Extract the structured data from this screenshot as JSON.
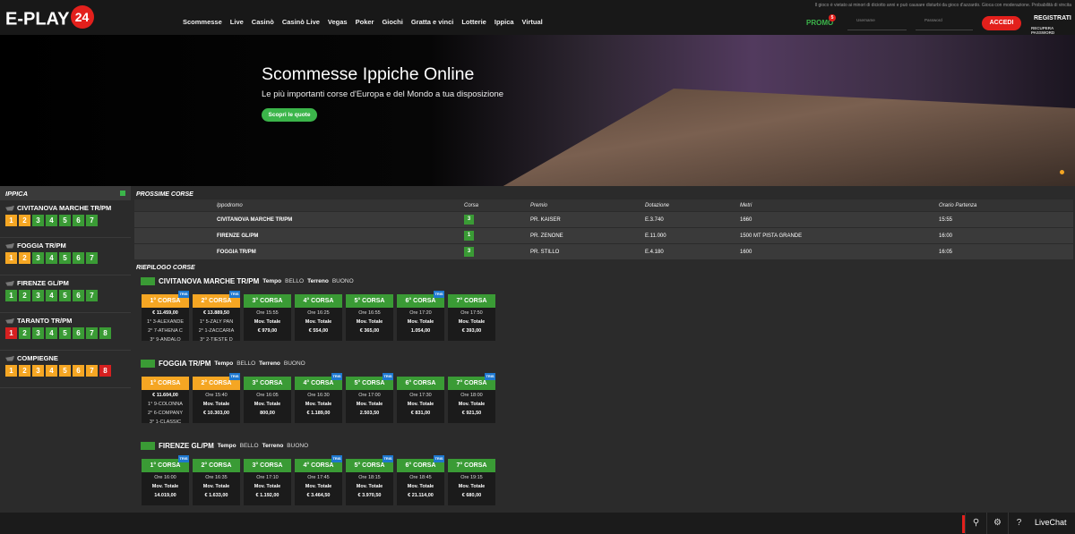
{
  "header": {
    "logo_text": "E-PLAY",
    "logo_num": "24",
    "nav": [
      "Scommesse",
      "Live",
      "Casinò",
      "Casinò Live",
      "Vegas",
      "Poker",
      "Giochi",
      "Gratta e vinci",
      "Lotterie",
      "Ippica",
      "Virtual"
    ],
    "disclaimer": "Il gioco è vietato ai minori di diciotto anni e può causare disturbi da gioco d'azzardo. Gioca con moderazione. Probabilità di vincita",
    "promo_label": "PROMO",
    "promo_count": "5",
    "username_placeholder": "Username",
    "password_placeholder": "Password",
    "login_button": "ACCEDI",
    "register": "REGISTRATI",
    "recover": "RECUPERA PASSWORD"
  },
  "hero": {
    "title": "Scommesse Ippiche Online",
    "subtitle": "Le più importanti corse d'Europa e del Mondo a tua disposizione",
    "cta": "Scopri le quote"
  },
  "sidebar": {
    "title": "IPPICA",
    "venues": [
      {
        "name": "CIVITANOVA MARCHE TR/PM",
        "races": [
          [
            "1",
            "o"
          ],
          [
            "2",
            "o"
          ],
          [
            "3",
            "g"
          ],
          [
            "4",
            "g"
          ],
          [
            "5",
            "g"
          ],
          [
            "6",
            "g"
          ],
          [
            "7",
            "g"
          ]
        ]
      },
      {
        "name": "FOGGIA TR/PM",
        "races": [
          [
            "1",
            "o"
          ],
          [
            "2",
            "o"
          ],
          [
            "3",
            "g"
          ],
          [
            "4",
            "g"
          ],
          [
            "5",
            "g"
          ],
          [
            "6",
            "g"
          ],
          [
            "7",
            "g"
          ]
        ]
      },
      {
        "name": "FIRENZE GL/PM",
        "races": [
          [
            "1",
            "g"
          ],
          [
            "2",
            "g"
          ],
          [
            "3",
            "g"
          ],
          [
            "4",
            "g"
          ],
          [
            "5",
            "g"
          ],
          [
            "6",
            "g"
          ],
          [
            "7",
            "g"
          ]
        ]
      },
      {
        "name": "TARANTO TR/PM",
        "races": [
          [
            "1",
            "r"
          ],
          [
            "2",
            "g"
          ],
          [
            "3",
            "g"
          ],
          [
            "4",
            "g"
          ],
          [
            "5",
            "g"
          ],
          [
            "6",
            "g"
          ],
          [
            "7",
            "g"
          ],
          [
            "8",
            "g"
          ]
        ]
      },
      {
        "name": "COMPIEGNE",
        "races": [
          [
            "1",
            "o"
          ],
          [
            "2",
            "o"
          ],
          [
            "3",
            "o"
          ],
          [
            "4",
            "o"
          ],
          [
            "5",
            "o"
          ],
          [
            "6",
            "o"
          ],
          [
            "7",
            "o"
          ],
          [
            "8",
            "r"
          ]
        ]
      }
    ]
  },
  "prossime": {
    "title": "PROSSIME CORSE",
    "headers": [
      "Ippodromo",
      "Corsa",
      "Premio",
      "Dotazione",
      "Metri",
      "Orario Partenza"
    ],
    "rows": [
      {
        "ippodromo": "CIVITANOVA MARCHE TR/PM",
        "corsa": "3",
        "premio": "PR. KAISER",
        "dotazione": "E.3.740",
        "metri": "1660",
        "orario": "15:55"
      },
      {
        "ippodromo": "FIRENZE GL/PM",
        "corsa": "1",
        "premio": "PR. ZENONE",
        "dotazione": "E.11.000",
        "metri": "1500 MT PISTA GRANDE",
        "orario": "16:00"
      },
      {
        "ippodromo": "FOGGIA TR/PM",
        "corsa": "3",
        "premio": "PR. STILLO",
        "dotazione": "E.4.180",
        "metri": "1600",
        "orario": "16:05"
      }
    ]
  },
  "riepilogo": {
    "title": "RIEPILOGO CORSE",
    "tempo_label": "Tempo",
    "terreno_label": "Terreno",
    "blocks": [
      {
        "name": "CIVITANOVA MARCHE TR/PM",
        "tempo": "BELLO",
        "terreno": "BUONO",
        "cards": [
          {
            "label": "1° CORSA",
            "c": "o",
            "tris": true,
            "l1": "€ 11.459,00",
            "l2": "1° 3-ALEXANDE",
            "l3": "2° 7-ATHENA C",
            "l4": "3° 9-ANDALO"
          },
          {
            "label": "2° CORSA",
            "c": "o",
            "tris": true,
            "l1": "€ 13.889,50",
            "l2": "1° 5-ZALY PAN",
            "l3": "2° 1-ZACCARIA",
            "l4": "3° 2-TIESTE D"
          },
          {
            "label": "3° CORSA",
            "c": "g",
            "tris": false,
            "l1": "Ore 15:55",
            "l2": "Mov. Totale",
            "l3": "€ 979,00",
            "l4": ""
          },
          {
            "label": "4° CORSA",
            "c": "g",
            "tris": false,
            "l1": "Ore 16:25",
            "l2": "Mov. Totale",
            "l3": "€ 554,00",
            "l4": ""
          },
          {
            "label": "5° CORSA",
            "c": "g",
            "tris": false,
            "l1": "Ore 16:55",
            "l2": "Mov. Totale",
            "l3": "€ 365,00",
            "l4": ""
          },
          {
            "label": "6° CORSA",
            "c": "g",
            "tris": true,
            "l1": "Ore 17:20",
            "l2": "Mov. Totale",
            "l3": "1.054,00",
            "l4": ""
          },
          {
            "label": "7° CORSA",
            "c": "g",
            "tris": false,
            "l1": "Ore 17:50",
            "l2": "Mov. Totale",
            "l3": "€ 393,00",
            "l4": ""
          }
        ]
      },
      {
        "name": "FOGGIA TR/PM",
        "tempo": "BELLO",
        "terreno": "BUONO",
        "cards": [
          {
            "label": "1° CORSA",
            "c": "o",
            "tris": false,
            "l1": "€ 11.604,00",
            "l2": "1° 9-COLONNA",
            "l3": "2° 6-COMPANY",
            "l4": "3° 1-CLASSIC"
          },
          {
            "label": "2° CORSA",
            "c": "o",
            "tris": true,
            "l1": "Ore 15:40",
            "l2": "Mov. Totale",
            "l3": "€ 10.303,00",
            "l4": ""
          },
          {
            "label": "3° CORSA",
            "c": "g",
            "tris": false,
            "l1": "Ore 16:05",
            "l2": "Mov. Totale",
            "l3": "800,00",
            "l4": ""
          },
          {
            "label": "4° CORSA",
            "c": "g",
            "tris": true,
            "l1": "Ore 16:30",
            "l2": "Mov. Totale",
            "l3": "€ 1.189,00",
            "l4": ""
          },
          {
            "label": "5° CORSA",
            "c": "g",
            "tris": true,
            "l1": "Ore 17:00",
            "l2": "Mov. Totale",
            "l3": "2.503,50",
            "l4": ""
          },
          {
            "label": "6° CORSA",
            "c": "g",
            "tris": false,
            "l1": "Ore 17:30",
            "l2": "Mov. Totale",
            "l3": "€ 831,00",
            "l4": ""
          },
          {
            "label": "7° CORSA",
            "c": "g",
            "tris": true,
            "l1": "Ore 18:00",
            "l2": "Mov. Totale",
            "l3": "€ 921,50",
            "l4": ""
          }
        ]
      },
      {
        "name": "FIRENZE GL/PM",
        "tempo": "BELLO",
        "terreno": "BUONO",
        "cards": [
          {
            "label": "1° CORSA",
            "c": "g",
            "tris": true,
            "l1": "Ore 16:00",
            "l2": "Mov. Totale",
            "l3": "14.019,00",
            "l4": ""
          },
          {
            "label": "2° CORSA",
            "c": "g",
            "tris": false,
            "l1": "Ore 16:35",
            "l2": "Mov. Totale",
            "l3": "€ 1.633,00",
            "l4": ""
          },
          {
            "label": "3° CORSA",
            "c": "g",
            "tris": false,
            "l1": "Ore 17:10",
            "l2": "Mov. Totale",
            "l3": "€ 1.192,00",
            "l4": ""
          },
          {
            "label": "4° CORSA",
            "c": "g",
            "tris": true,
            "l1": "Ore 17:45",
            "l2": "Mov. Totale",
            "l3": "€ 3.464,50",
            "l4": ""
          },
          {
            "label": "5° CORSA",
            "c": "g",
            "tris": true,
            "l1": "Ore 18:15",
            "l2": "Mov. Totale",
            "l3": "€ 3.970,50",
            "l4": ""
          },
          {
            "label": "6° CORSA",
            "c": "g",
            "tris": true,
            "l1": "Ore 18:45",
            "l2": "Mov. Totale",
            "l3": "€ 21.114,00",
            "l4": ""
          },
          {
            "label": "7° CORSA",
            "c": "g",
            "tris": false,
            "l1": "Ore 19:15",
            "l2": "Mov. Totale",
            "l3": "€ 680,00",
            "l4": ""
          }
        ]
      }
    ]
  },
  "tris_label": "TRIS",
  "bottombar": {
    "livechat": "LiveChat"
  }
}
